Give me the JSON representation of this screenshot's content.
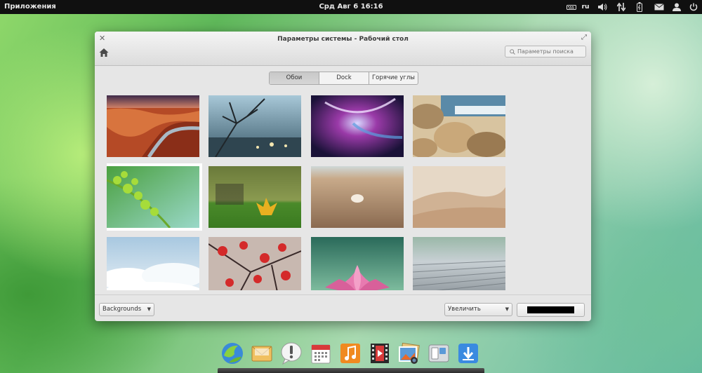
{
  "top_panel": {
    "apps_label": "Приложения",
    "clock": "Срд Авг  6 16:16",
    "keyboard_layout": "ru"
  },
  "window": {
    "title": "Параметры системы - Рабочий стол",
    "search_placeholder": "Параметры поиска",
    "tabs": [
      {
        "label": "Обои",
        "active": true
      },
      {
        "label": "Dock",
        "active": false
      },
      {
        "label": "Горячие углы",
        "active": false
      }
    ],
    "wallpapers": [
      {
        "name": "canyon",
        "selected": false
      },
      {
        "name": "branches-city",
        "selected": false
      },
      {
        "name": "nebula",
        "selected": false
      },
      {
        "name": "rocky-shore",
        "selected": false
      },
      {
        "name": "green-leaves",
        "selected": true
      },
      {
        "name": "yellow-leaf",
        "selected": false
      },
      {
        "name": "seashell-sand",
        "selected": false
      },
      {
        "name": "sand-dunes",
        "selected": false
      },
      {
        "name": "clouds",
        "selected": false
      },
      {
        "name": "red-maple",
        "selected": false
      },
      {
        "name": "pink-lotus",
        "selected": false
      },
      {
        "name": "metal-texture",
        "selected": false
      }
    ],
    "folder_dropdown": "Backgrounds",
    "mode_dropdown": "Увеличить",
    "background_color": "#000000"
  },
  "dock": {
    "apps": [
      "browser",
      "mail",
      "messaging",
      "calendar",
      "music",
      "video",
      "photos",
      "switchboard",
      "software-updates"
    ]
  }
}
